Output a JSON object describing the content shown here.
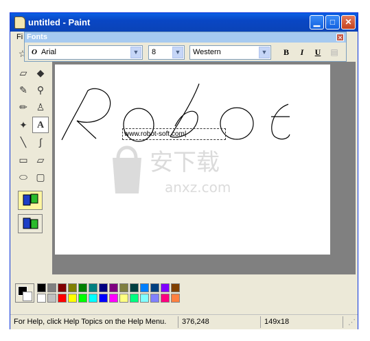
{
  "window": {
    "title": "untitled - Paint"
  },
  "menubar": {
    "first_item": "Fi"
  },
  "fonts_toolbar": {
    "title": "Fonts",
    "font_name": "Arial",
    "font_size": "8",
    "script": "Western",
    "bold_label": "B",
    "italic_label": "I",
    "underline_label": "U"
  },
  "canvas": {
    "text_box_value": "www.robot-soft.com",
    "drawn_text": "Robot"
  },
  "watermark": {
    "text": "安下载",
    "sub": "anxz.com"
  },
  "status": {
    "help_text": "For Help, click Help Topics on the Help Menu.",
    "coordinates": "376,248",
    "selection_size": "149x18"
  },
  "palette": {
    "foreground": "#000000",
    "background": "#ffffff",
    "top_row": [
      "#000000",
      "#808080",
      "#800000",
      "#808000",
      "#008000",
      "#008080",
      "#000080",
      "#800080",
      "#808040",
      "#004040",
      "#0080ff",
      "#004080",
      "#8000ff",
      "#804000"
    ],
    "bottom_row": [
      "#ffffff",
      "#c0c0c0",
      "#ff0000",
      "#ffff00",
      "#00ff00",
      "#00ffff",
      "#0000ff",
      "#ff00ff",
      "#ffff80",
      "#00ff80",
      "#80ffff",
      "#8080ff",
      "#ff0080",
      "#ff8040"
    ]
  }
}
